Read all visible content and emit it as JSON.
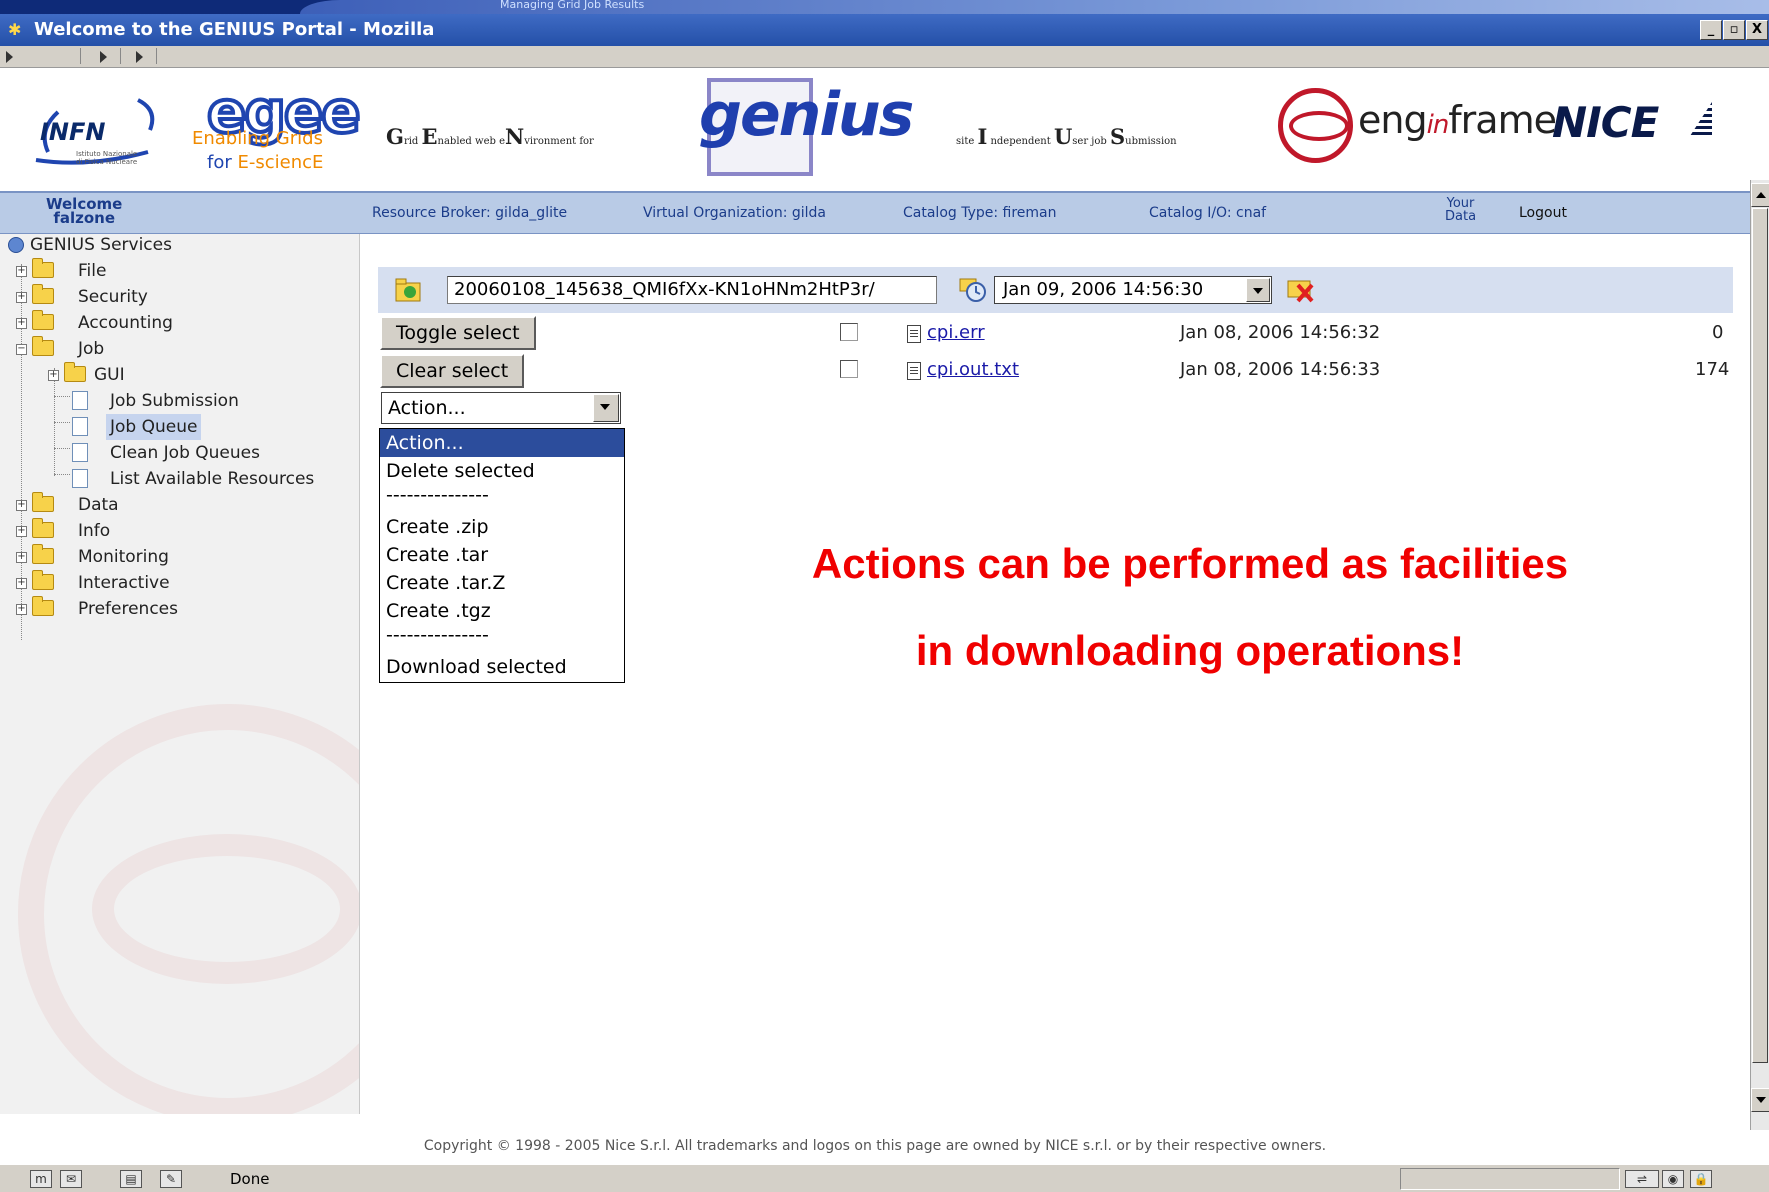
{
  "slide_header": {
    "text": "Managing Grid Job Results"
  },
  "window": {
    "title": "Welcome to the GENIUS Portal - Mozilla",
    "controls": [
      "_",
      "▫",
      "X"
    ]
  },
  "banner": {
    "infn": {
      "name": "INFN",
      "subtitle_line1": "Istituto Nazionale",
      "subtitle_line2": "di Fisica Nucleare"
    },
    "egee": {
      "wordmark": "egee",
      "line1_a": "Enabling ",
      "line1_b": "Grids",
      "line2_a": "for ",
      "line2_b": "E-sciencE"
    },
    "genius_caption": {
      "g": "G",
      "g_rest": "rid ",
      "e": "E",
      "e_rest": "nabled web e",
      "n": "N",
      "n_rest": "vironment for"
    },
    "genius_word": "genius",
    "siius_caption": {
      "a": "site ",
      "i": "I",
      "i_rest": " ndependent ",
      "u": "U",
      "u_rest": "ser job ",
      "s": "S",
      "s_rest": "ubmission"
    },
    "enginframe": {
      "a": "eng",
      "b": "in",
      "c": "frame"
    },
    "nice": "NICE"
  },
  "infobar": {
    "welcome_line1": "Welcome",
    "welcome_line2": "falzone",
    "resource_broker": "Resource Broker: gilda_glite",
    "virtual_org": "Virtual Organization: gilda",
    "catalog_type": "Catalog Type: fireman",
    "catalog_io": "Catalog I/O: cnaf",
    "your_data_line1": "Your",
    "your_data_line2": "Data",
    "logout": "Logout"
  },
  "sidebar": {
    "root": "GENIUS Services",
    "items": [
      {
        "label": "File"
      },
      {
        "label": "Security"
      },
      {
        "label": "Accounting"
      },
      {
        "label": "Job"
      },
      {
        "label": "GUI"
      },
      {
        "label": "Job Submission"
      },
      {
        "label": "Job Queue"
      },
      {
        "label": "Clean Job Queues"
      },
      {
        "label": "List Available Resources"
      },
      {
        "label": "Data"
      },
      {
        "label": "Info"
      },
      {
        "label": "Monitoring"
      },
      {
        "label": "Interactive"
      },
      {
        "label": "Preferences"
      }
    ]
  },
  "toolbar": {
    "job_path": "20060108_145638_QMI6fXx-KN1oHNm2HtP3r/",
    "date_selected": "Jan 09, 2006 14:56:30"
  },
  "actions": {
    "toggle_select": "Toggle select",
    "clear_select": "Clear select",
    "select_value": "Action...",
    "options": [
      "Action...",
      "Delete selected",
      "---------------",
      "Create .zip",
      "Create .tar",
      "Create .tar.Z",
      "Create .tgz",
      "---------------",
      "Download selected"
    ]
  },
  "files": [
    {
      "name": "cpi.err",
      "date": "Jan 08, 2006 14:56:32",
      "size": "0"
    },
    {
      "name": "cpi.out.txt",
      "date": "Jan 08, 2006 14:56:33",
      "size": "174"
    }
  ],
  "annotation": {
    "line1": "Actions can be performed as facilities",
    "line2": "in downloading operations!"
  },
  "footer": "Copyright © 1998 - 2005 Nice S.r.l. All trademarks and logos on this page are owned by NICE s.r.l. or by their respective owners.",
  "statusbar": {
    "status": "Done"
  },
  "colors": {
    "titlebar": "#2450a8",
    "infobar": "#b9cbe6",
    "annotation": "#f00000",
    "selected_option": "#2c4d9c",
    "link": "#1a1aa8"
  }
}
